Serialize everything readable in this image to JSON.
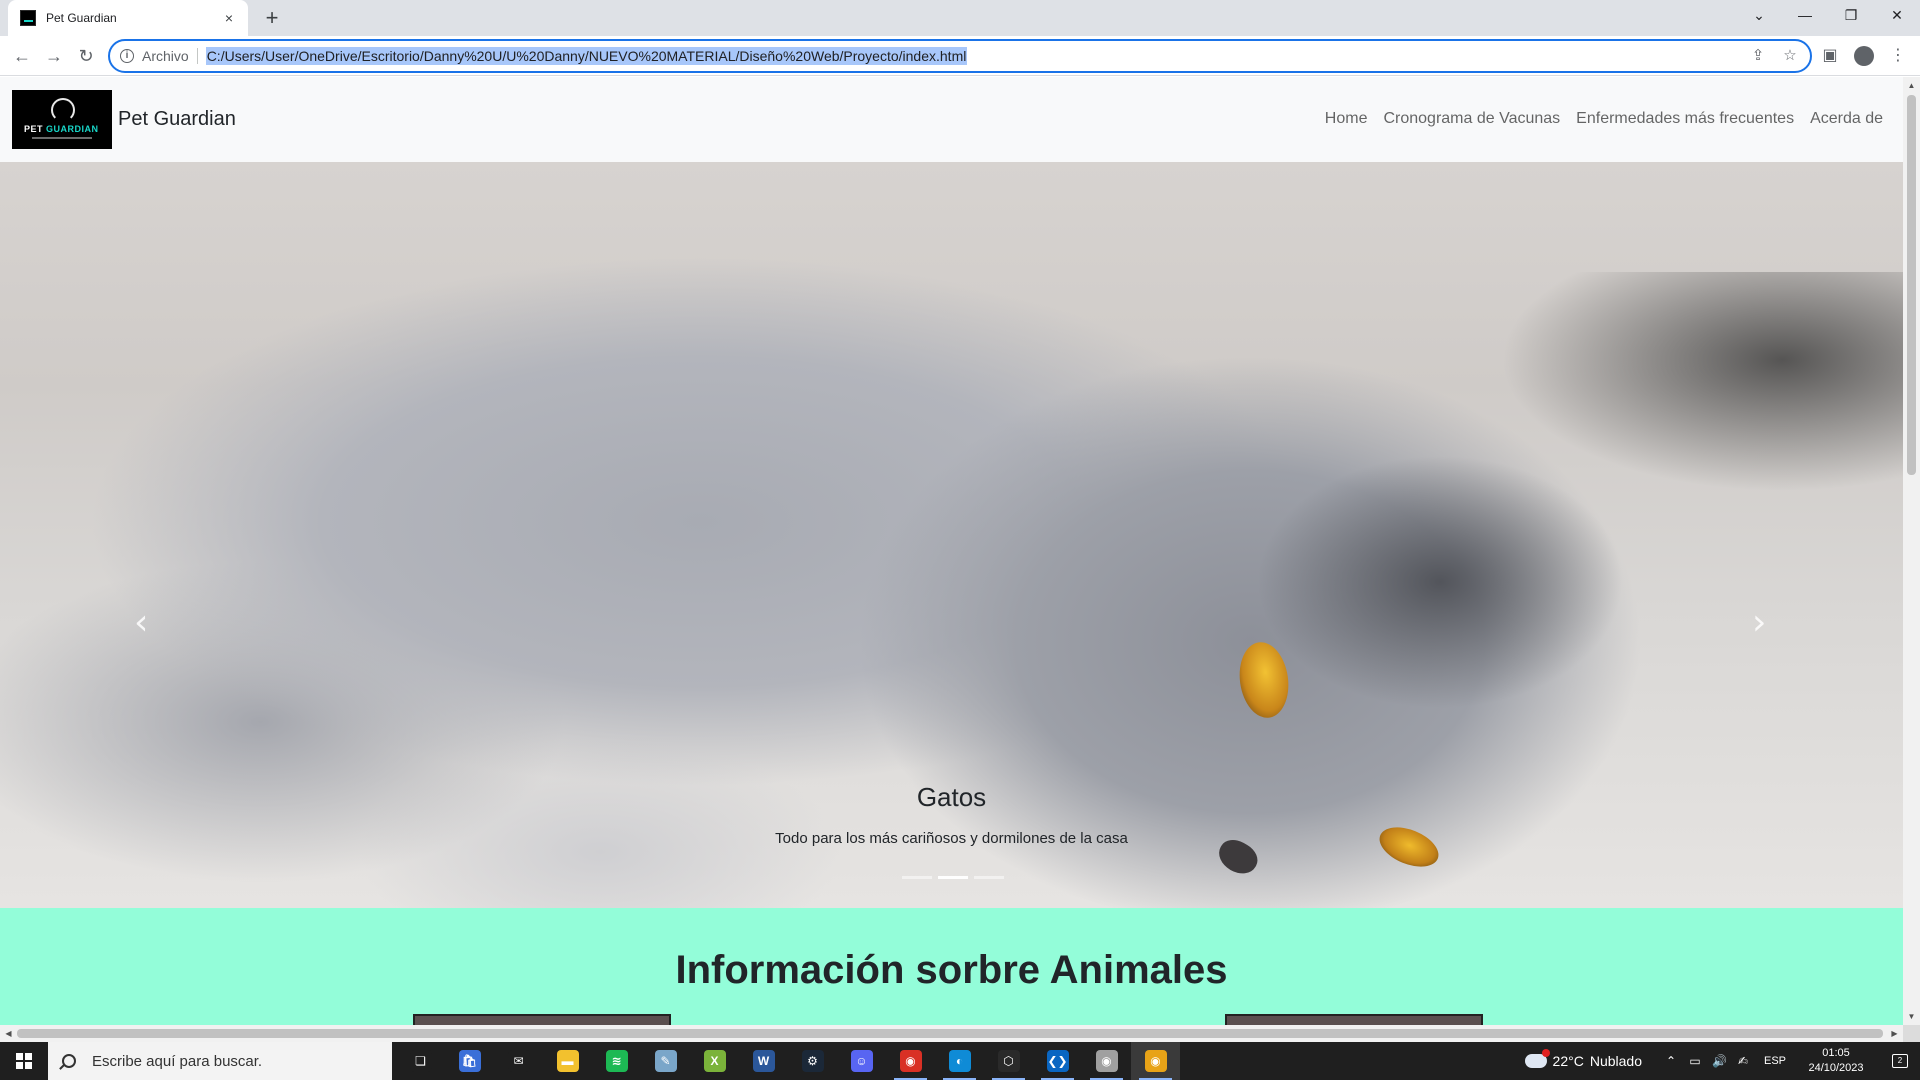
{
  "browser": {
    "tab_title": "Pet Guardian",
    "tab_close_icon": "×",
    "new_tab_icon": "+",
    "window_controls": [
      "⌄",
      "—",
      "❐",
      "✕"
    ],
    "scheme_label": "Archivo",
    "url": "C:/Users/User/OneDrive/Escritorio/Danny%20U/U%20Danny/NUEVO%20MATERIAL/Diseño%20Web/Proyecto/index.html",
    "back_icon": "←",
    "forward_icon": "→",
    "reload_icon": "↻",
    "info_icon": "i",
    "share_icon": "⇪",
    "bookmark_icon": "☆",
    "side_panel_icon": "▣",
    "menu_icon": "⋮",
    "accent": "#1a73e8"
  },
  "site": {
    "brand_name": "Pet Guardian",
    "logo": {
      "word1": "PET",
      "word2": "GUARDIAN"
    },
    "nav": [
      "Home",
      "Cronograma de Vacunas",
      "Enfermedades más frecuentes",
      "Acerda de"
    ],
    "carousel": {
      "prev_icon": "‹",
      "next_icon": "›",
      "caption_title": "Gatos",
      "caption_text": "Todo para los más cariñosos y dormilones de la casa",
      "slide_count": 3,
      "active_index": 1
    },
    "info_section": {
      "title": "Información sorbre Animales",
      "background": "#93fdd9"
    }
  },
  "scrollbars": {
    "up": "▲",
    "down": "▼",
    "left": "◀",
    "right": "▶"
  },
  "taskbar": {
    "search_placeholder": "Escribe aquí para buscar.",
    "apps": [
      {
        "name": "task-view-icon",
        "glyph": "❏",
        "color": "#1f1f1f"
      },
      {
        "name": "store-icon",
        "glyph": "🛍",
        "color": "#3a6fd8"
      },
      {
        "name": "mail-icon",
        "glyph": "✉",
        "color": "#1f1f1f"
      },
      {
        "name": "file-explorer-icon",
        "glyph": "▬",
        "color": "#f2c12e"
      },
      {
        "name": "spotify-icon",
        "glyph": "≋",
        "color": "#1db954"
      },
      {
        "name": "notes-icon",
        "glyph": "✎",
        "color": "#7aa6c9"
      },
      {
        "name": "excel-vscode-icon",
        "glyph": "X",
        "color": "#7bb33a"
      },
      {
        "name": "word-icon",
        "glyph": "W",
        "color": "#2b579a"
      },
      {
        "name": "steam-icon",
        "glyph": "⚙",
        "color": "#1b2838"
      },
      {
        "name": "discord-icon",
        "glyph": "☺",
        "color": "#5865f2"
      },
      {
        "name": "chrome-dev-icon",
        "glyph": "◉",
        "color": "#d93025"
      },
      {
        "name": "edge-icon",
        "glyph": "◐",
        "color": "#0f8bd6"
      },
      {
        "name": "unity-icon",
        "glyph": "⬡",
        "color": "#2a2a2a"
      },
      {
        "name": "vscode-icon",
        "glyph": "❮❯",
        "color": "#0a66c2"
      },
      {
        "name": "chrome-canary-icon",
        "glyph": "◉",
        "color": "#a0a0a0"
      },
      {
        "name": "chrome-icon",
        "glyph": "◉",
        "color": "#e8a317"
      }
    ],
    "weather_temp": "22°C",
    "weather_desc": "Nublado",
    "tray_glyphs": [
      "⌃",
      "▭",
      "🔊",
      "✍"
    ],
    "language": "ESP",
    "time": "01:05",
    "date": "24/10/2023",
    "notification_badge": "2"
  }
}
